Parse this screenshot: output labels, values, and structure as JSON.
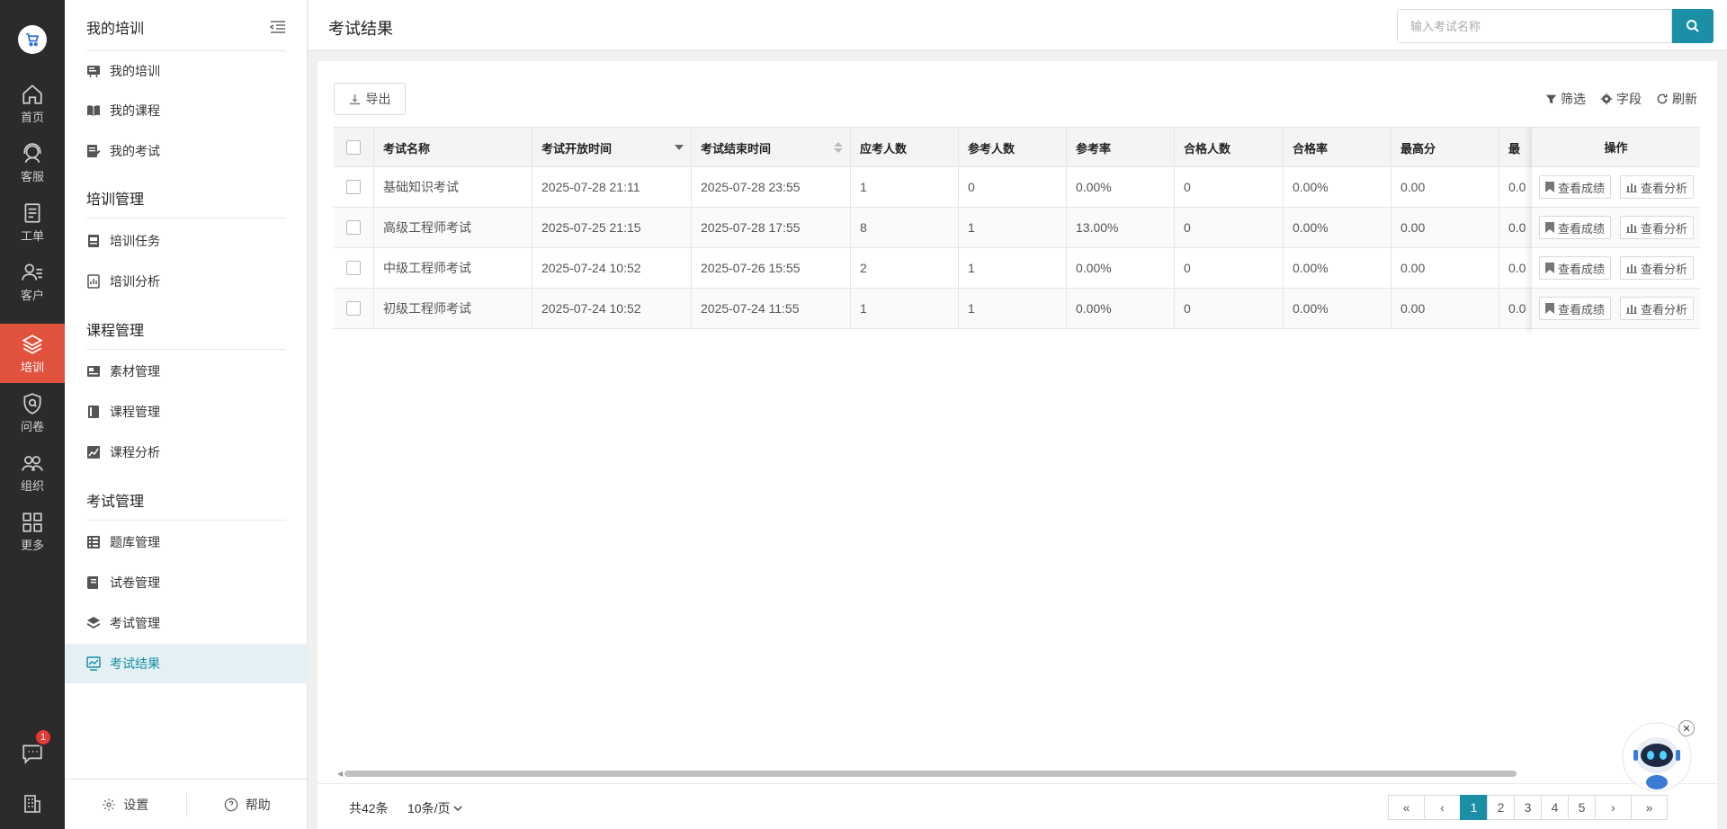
{
  "rail": {
    "items": [
      {
        "label": "首页",
        "icon": "home-icon"
      },
      {
        "label": "客服",
        "icon": "headset-icon"
      },
      {
        "label": "工单",
        "icon": "clipboard-icon"
      },
      {
        "label": "客户",
        "icon": "customers-icon"
      },
      {
        "label": "培训",
        "icon": "layers-icon"
      },
      {
        "label": "问卷",
        "icon": "survey-icon"
      },
      {
        "label": "组织",
        "icon": "team-icon"
      },
      {
        "label": "更多",
        "icon": "grid-icon"
      }
    ],
    "active_index": 4,
    "notification_badge": "1",
    "accent": "#e0523c"
  },
  "sidebar": {
    "header": "我的培训",
    "my_items": [
      {
        "label": "我的培训",
        "icon": "presentation-icon"
      },
      {
        "label": "我的课程",
        "icon": "book-open-icon"
      },
      {
        "label": "我的考试",
        "icon": "exam-edit-icon"
      }
    ],
    "section_training": "培训管理",
    "training_items": [
      {
        "label": "培训任务",
        "icon": "task-icon"
      },
      {
        "label": "培训分析",
        "icon": "analysis-icon"
      }
    ],
    "section_course": "课程管理",
    "course_items": [
      {
        "label": "素材管理",
        "icon": "material-icon"
      },
      {
        "label": "课程管理",
        "icon": "course-icon"
      },
      {
        "label": "课程分析",
        "icon": "trend-chart-icon"
      }
    ],
    "section_exam": "考试管理",
    "exam_items": [
      {
        "label": "题库管理",
        "icon": "question-bank-icon"
      },
      {
        "label": "试卷管理",
        "icon": "paper-icon"
      },
      {
        "label": "考试管理",
        "icon": "stack-icon"
      },
      {
        "label": "考试结果",
        "icon": "result-chart-icon"
      }
    ],
    "footer": {
      "settings": "设置",
      "help": "帮助"
    }
  },
  "topbar": {
    "title": "考试结果",
    "search_placeholder": "输入考试名称",
    "accent": "#1a8fa6"
  },
  "toolbar": {
    "export": "导出",
    "filter": "筛选",
    "fields": "字段",
    "refresh": "刷新"
  },
  "table": {
    "headers": {
      "name": "考试名称",
      "start": "考试开放时间",
      "end": "考试结束时间",
      "expected": "应考人数",
      "attended": "参考人数",
      "rate": "参考率",
      "passed": "合格人数",
      "pass_rate": "合格率",
      "max": "最高分",
      "min_partial": "最",
      "ops": "操作"
    },
    "rows": [
      {
        "name": "基础知识考试",
        "start": "2025-07-28 21:11",
        "end": "2025-07-28 23:55",
        "expected": "1",
        "attended": "0",
        "rate": "0.00%",
        "passed": "0",
        "pass_rate": "0.00%",
        "max": "0.00",
        "min_partial": "0.0"
      },
      {
        "name": "高级工程师考试",
        "start": "2025-07-25 21:15",
        "end": "2025-07-28 17:55",
        "expected": "8",
        "attended": "1",
        "rate": "13.00%",
        "passed": "0",
        "pass_rate": "0.00%",
        "max": "0.00",
        "min_partial": "0.0"
      },
      {
        "name": "中级工程师考试",
        "start": "2025-07-24 10:52",
        "end": "2025-07-26 15:55",
        "expected": "2",
        "attended": "1",
        "rate": "0.00%",
        "passed": "0",
        "pass_rate": "0.00%",
        "max": "0.00",
        "min_partial": "0.0"
      },
      {
        "name": "初级工程师考试",
        "start": "2025-07-24 10:52",
        "end": "2025-07-24 11:55",
        "expected": "1",
        "attended": "1",
        "rate": "0.00%",
        "passed": "0",
        "pass_rate": "0.00%",
        "max": "0.00",
        "min_partial": "0.0"
      }
    ],
    "row_actions": {
      "view_scores": "查看成绩",
      "view_analysis": "查看分析"
    }
  },
  "pagination": {
    "total": "共42条",
    "page_size": "10条/页",
    "first": "«",
    "prev": "‹",
    "pages": [
      "1",
      "2",
      "3",
      "4",
      "5"
    ],
    "current_page": "1",
    "next": "›",
    "last": "»"
  }
}
